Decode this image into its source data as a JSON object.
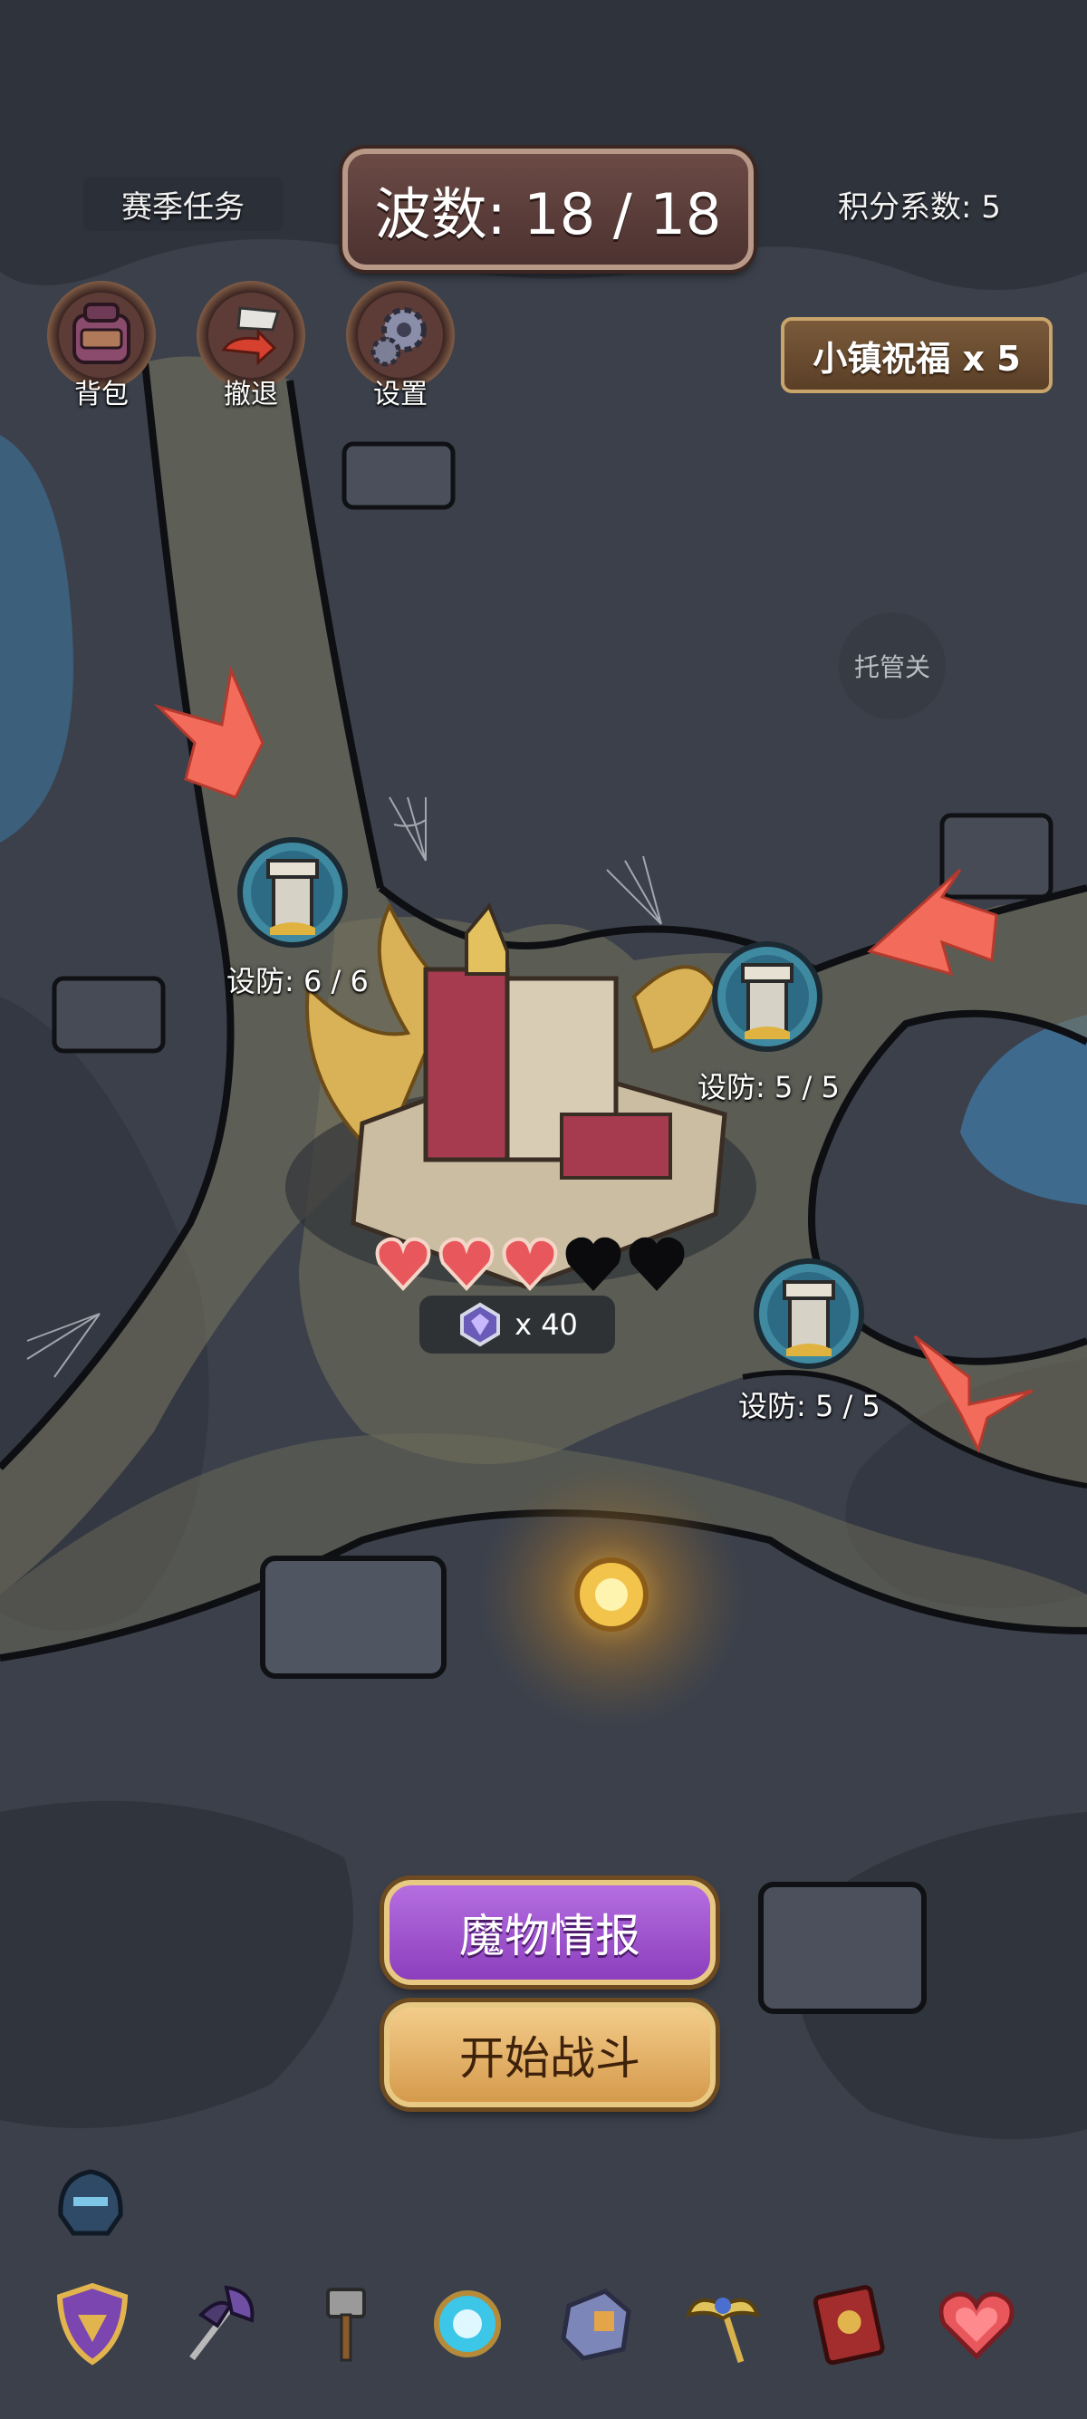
{
  "hud": {
    "season_tasks": "赛季任务",
    "wave_label": "波数: 18 / 18",
    "score_multiplier": "积分系数: 5",
    "blessing": "小镇祝福 x 5",
    "auto_pass": "托管关"
  },
  "top_buttons": [
    {
      "label": "背包",
      "icon": "backpack-icon"
    },
    {
      "label": "撤退",
      "icon": "retreat-flag-icon"
    },
    {
      "label": "设置",
      "icon": "gear-icon"
    }
  ],
  "towers": [
    {
      "label": "设防: 6 / 6"
    },
    {
      "label": "设防: 5 / 5"
    },
    {
      "label": "设防: 5 / 5"
    }
  ],
  "base": {
    "hearts_filled": 3,
    "hearts_total": 5,
    "crystal_count": "x 40"
  },
  "buttons": {
    "monster_intel": "魔物情报",
    "start_battle": "开始战斗"
  },
  "bottom_bar": [
    "helmet-icon",
    "shield-icon",
    "axe-icon",
    "hammer-icon",
    "magic-orb-icon",
    "rune-stone-icon",
    "winged-staff-icon",
    "spellbook-icon",
    "heart-icon"
  ],
  "colors": {
    "arrow": "#f26b5b",
    "intel_button": "#9b4fcc",
    "start_button": "#e6b46a",
    "heart": "#e8575b"
  }
}
